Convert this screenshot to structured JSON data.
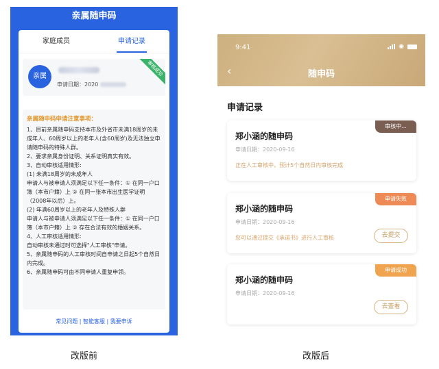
{
  "before": {
    "title": "亲属随申码",
    "tabs": [
      {
        "label": "家庭成员",
        "active": false
      },
      {
        "label": "申请记录",
        "active": true
      }
    ],
    "application": {
      "avatar_text": "亲属",
      "date_label": "申请日期：",
      "date_visible": "2020",
      "status": "审核成功"
    },
    "notice": {
      "title": "亲属随申码申请注意事项：",
      "lines": [
        "1、目前亲属随申码支持本市及外省市未满18周岁的未成年人、60周岁以上的老年人(含60周岁)及无法独立申请随申码的特殊人群。",
        "2、要求亲属身份证明、关系证明真实有效。",
        "3、自动审核适用情形:",
        "(1) 未满18周岁的未成年人",
        "申请人与被申请人须满足以下任一条件：① 在同一户口簿（本市户籍）上 ② 在同一张本市出生医学证明（2008年以后）上。",
        "(2) 年满60周岁以上的老年人及特殊人群",
        "申请人与被申请人须满足以下任一条件：① 在同一户口簿（本市户籍）上 ② 存在合法有效的婚姻关系。",
        "4、人工审核适用情形:",
        "自动审核未通过时可选择\"人工审核\"申请。",
        "5、亲属随申码的人工审核时间自申请之日起5个自然日内完成。",
        "6、亲属随申码可由不同申请人重复申领。"
      ]
    },
    "footer": "常见问题 | 智能客服 | 我要申诉",
    "caption": "改版前"
  },
  "after": {
    "status_time": "9:41",
    "title": "随申码",
    "section_title": "申请记录",
    "records": [
      {
        "name": "郑小涵的随申码",
        "date": "申请日期：2020-09-16",
        "status": "审核中...",
        "status_color": "#7a5e52",
        "message": "正在人工审核中，预计5个自然日内审核完成",
        "button": ""
      },
      {
        "name": "郑小涵的随申码",
        "date": "申请日期：2020-09-16",
        "status": "申请失败",
        "status_color": "#ee8a55",
        "message": "您可以通过提交《承诺书》进行人工审核",
        "button": "去提交"
      },
      {
        "name": "郑小涵的随申码",
        "date": "申请日期：2020-09-16",
        "status": "申请成功",
        "status_color": "#f0a44f",
        "message": "",
        "button": "去查看"
      }
    ],
    "caption": "改版后"
  }
}
